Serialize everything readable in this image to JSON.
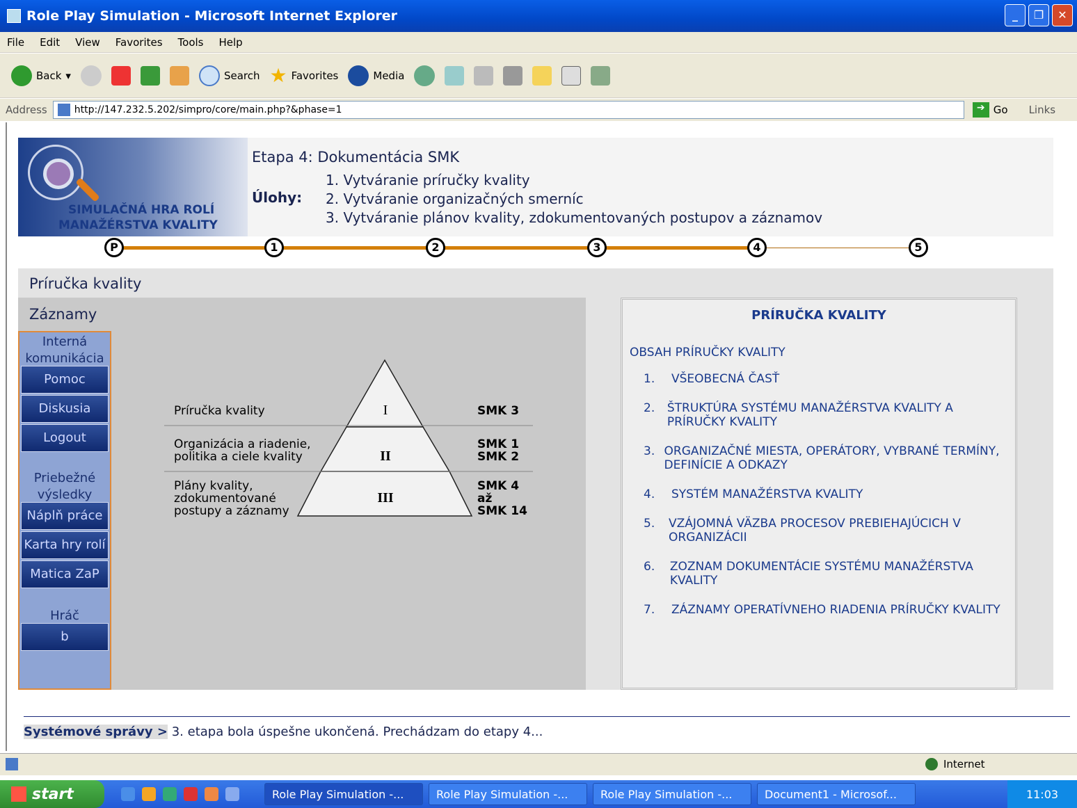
{
  "window": {
    "title": "Role Play Simulation - Microsoft Internet Explorer"
  },
  "menu": [
    "File",
    "Edit",
    "View",
    "Favorites",
    "Tools",
    "Help"
  ],
  "toolbar": {
    "back": "Back",
    "search": "Search",
    "favorites": "Favorites",
    "media": "Media"
  },
  "address": {
    "label": "Address",
    "url": "http://147.232.5.202/simpro/core/main.php?&phase=1",
    "go": "Go",
    "links": "Links"
  },
  "header": {
    "logo_line1": "SIMULAČNÁ HRA ROLÍ",
    "logo_line2": "MANAŽÉRSTVA KVALITY",
    "etapa": "Etapa 4: Dokumentácia SMK",
    "ulohy_label": "Úlohy:",
    "ulohy": [
      "1. Vytváranie príručky kvality",
      "2. Vytváranie organizačných smerníc",
      "3. Vytváranie plánov kvality, zdokumentovaných postupov a záznamov"
    ]
  },
  "stepper": {
    "steps": [
      "P",
      "1",
      "2",
      "3",
      "4",
      "5"
    ],
    "current": 4
  },
  "section": {
    "title": "Príručka kvality",
    "subtitle": "Záznamy"
  },
  "nav": {
    "label1": [
      "Interná",
      "komunikácia"
    ],
    "buttons1": [
      "Pomoc",
      "Diskusia",
      "Logout"
    ],
    "label2": [
      "Priebežné",
      "výsledky"
    ],
    "buttons2": [
      "Náplň práce",
      "Karta hry rolí",
      "Matica ZaP"
    ],
    "label3": "Hráč",
    "player": "b"
  },
  "pyramid": {
    "levels": [
      {
        "label": [
          "Príručka kvality"
        ],
        "roman": "I",
        "smk": [
          "SMK 3"
        ]
      },
      {
        "label": [
          "Organizácia a riadenie,",
          "politika a ciele kvality"
        ],
        "roman": "II",
        "smk": [
          "SMK 1",
          "SMK 2"
        ]
      },
      {
        "label": [
          "Plány kvality,",
          "zdokumentované",
          "postupy a záznamy"
        ],
        "roman": "III",
        "smk": [
          "SMK 4",
          "až",
          "SMK 14"
        ]
      }
    ]
  },
  "doc": {
    "title": "PRÍRUČKA KVALITY",
    "subtitle": "OBSAH PRÍRUČKY KVALITY",
    "toc": [
      {
        "n": "1.",
        "t": "VŠEOBECNÁ ČASŤ"
      },
      {
        "n": "2.",
        "t": "ŠTRUKTÚRA SYSTÉMU MANAŽÉRSTVA KVALITY A PRÍRUČKY KVALITY"
      },
      {
        "n": "3.",
        "t": "ORGANIZAČNÉ MIESTA, OPERÁTORY, VYBRANÉ TERMÍNY, DEFINÍCIE A ODKAZY"
      },
      {
        "n": "4.",
        "t": "SYSTÉM MANAŽÉRSTVA KVALITY"
      },
      {
        "n": "5.",
        "t": "VZÁJOMNÁ VÄZBA PROCESOV PREBIEHAJÚCICH V ORGANIZÁCII"
      },
      {
        "n": "6.",
        "t": "ZOZNAM DOKUMENTÁCIE SYSTÉMU MANAŽÉRSTVA KVALITY"
      },
      {
        "n": "7.",
        "t": "ZÁZNAMY OPERATÍVNEHO RIADENIA PRÍRUČKY KVALITY"
      }
    ]
  },
  "messages": {
    "label": "Systémové správy >",
    "text": "3. etapa bola úspešne ukončená. Prechádzam do etapy 4..."
  },
  "status": {
    "zone": "Internet"
  },
  "taskbar": {
    "start": "start",
    "tasks": [
      "Role Play Simulation -...",
      "Role Play Simulation -...",
      "Role Play Simulation -...",
      "Document1 - Microsof..."
    ],
    "clock": "11:03"
  }
}
